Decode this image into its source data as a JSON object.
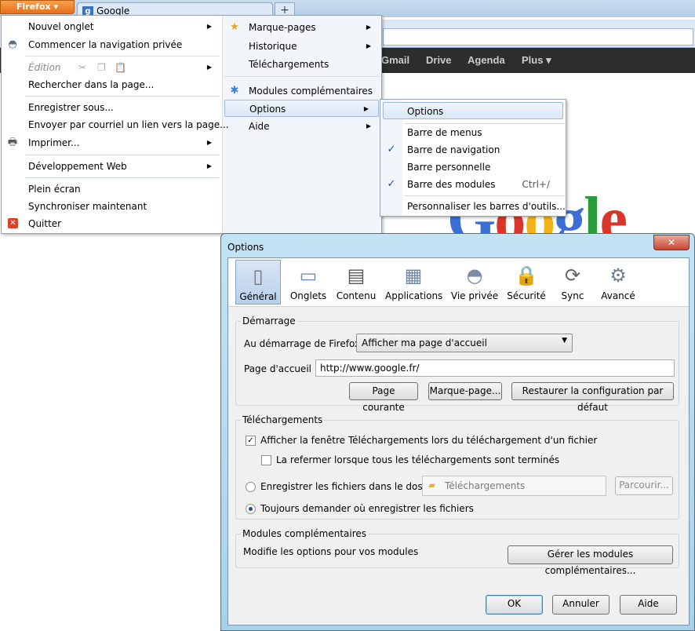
{
  "browser": {
    "firefox_button": "Firefox",
    "tab_title": "Google",
    "tab_favicon": "g-icon",
    "new_tab_symbol": "+",
    "google_bar": [
      "Gmail",
      "Drive",
      "Agenda",
      "Plus ▾"
    ],
    "logo_text": "Google"
  },
  "main_menu": {
    "items": [
      {
        "label": "Nouvel onglet",
        "icon": "",
        "arrow": "▶"
      },
      {
        "label": "Commencer la navigation privée",
        "icon": "mask-icon",
        "arrow": ""
      },
      {
        "label": "Édition",
        "icon": "",
        "arrow": "▶"
      },
      {
        "label": "Rechercher dans la page...",
        "icon": "",
        "arrow": ""
      },
      {
        "label": "Enregistrer sous...",
        "icon": "",
        "arrow": ""
      },
      {
        "label": "Envoyer par courriel un lien vers la page...",
        "icon": "",
        "arrow": ""
      },
      {
        "label": "Imprimer...",
        "icon": "printer-icon",
        "arrow": "▶"
      },
      {
        "label": "Développement Web",
        "icon": "",
        "arrow": "▶"
      },
      {
        "label": "Plein écran",
        "icon": "",
        "arrow": ""
      },
      {
        "label": "Synchroniser maintenant",
        "icon": "",
        "arrow": ""
      },
      {
        "label": "Quitter",
        "icon": "quit-icon",
        "arrow": ""
      }
    ],
    "right_items": [
      {
        "label": "Marque-pages",
        "icon": "star-icon",
        "arrow": "▶"
      },
      {
        "label": "Historique",
        "icon": "",
        "arrow": "▶"
      },
      {
        "label": "Téléchargements",
        "icon": "",
        "arrow": ""
      },
      {
        "label": "Modules complémentaires",
        "icon": "puzzle-icon",
        "arrow": ""
      },
      {
        "label": "Options",
        "icon": "",
        "arrow": "▶"
      },
      {
        "label": "Aide",
        "icon": "",
        "arrow": "▶"
      }
    ]
  },
  "options_submenu": {
    "items": [
      {
        "label": "Options",
        "checked": false,
        "shortcut": ""
      },
      {
        "label": "Barre de menus",
        "checked": false,
        "shortcut": ""
      },
      {
        "label": "Barre de navigation",
        "checked": true,
        "shortcut": ""
      },
      {
        "label": "Barre personnelle",
        "checked": false,
        "shortcut": ""
      },
      {
        "label": "Barre des modules",
        "checked": true,
        "shortcut": "Ctrl+/"
      },
      {
        "label": "Personnaliser les barres d'outils...",
        "checked": false,
        "shortcut": ""
      }
    ],
    "check_symbol": "✓"
  },
  "dialog": {
    "title": "Options",
    "close_symbol": "✕",
    "panes": [
      {
        "label": "Général",
        "icon": "switch-icon",
        "glyph": "▯"
      },
      {
        "label": "Onglets",
        "icon": "tabs-icon",
        "glyph": "▭"
      },
      {
        "label": "Contenu",
        "icon": "content-icon",
        "glyph": "▤"
      },
      {
        "label": "Applications",
        "icon": "applications-icon",
        "glyph": "▦"
      },
      {
        "label": "Vie privée",
        "icon": "mask-icon",
        "glyph": "◓"
      },
      {
        "label": "Sécurité",
        "icon": "lock-icon",
        "glyph": "🔒"
      },
      {
        "label": "Sync",
        "icon": "sync-icon",
        "glyph": "⟳"
      },
      {
        "label": "Avancé",
        "icon": "gear-icon",
        "glyph": "⚙"
      }
    ],
    "startup": {
      "group_title": "Démarrage",
      "on_start_label": "Au démarrage de Firefox :",
      "on_start_value": "Afficher ma page d'accueil",
      "homepage_label": "Page d'accueil :",
      "homepage_value": "http://www.google.fr/",
      "btn_current": "Page courante",
      "btn_bookmark": "Marque-page...",
      "btn_restore": "Restaurer la configuration par défaut"
    },
    "downloads": {
      "group_title": "Téléchargements",
      "show_window": "Afficher la fenêtre Téléchargements lors du téléchargement d'un fichier",
      "show_window_checked": true,
      "close_when_done": "La refermer lorsque tous les téléchargements sont terminés",
      "close_when_done_checked": false,
      "save_to": "Enregistrer les fichiers dans le dossier",
      "folder": "Téléchargements",
      "browse": "Parcourir...",
      "always_ask": "Toujours demander où enregistrer les fichiers",
      "selected_option": "always_ask"
    },
    "addons": {
      "group_title": "Modules complémentaires",
      "description": "Modifie les options pour vos modules",
      "manage_button": "Gérer les modules complémentaires..."
    },
    "footer": {
      "ok": "OK",
      "cancel": "Annuler",
      "help": "Aide"
    }
  }
}
